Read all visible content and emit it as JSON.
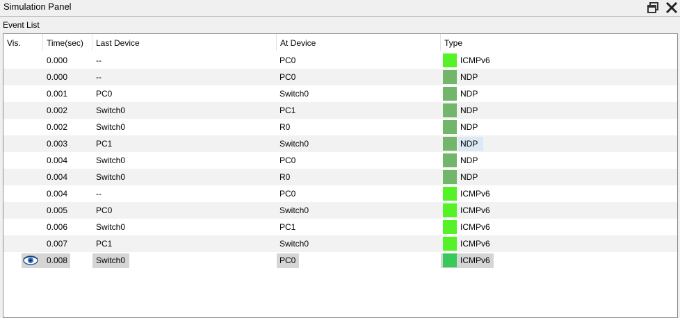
{
  "window": {
    "title": "Simulation Panel",
    "restore_icon": "restore-window-icon",
    "close_icon": "close-icon"
  },
  "event_list": {
    "label": "Event List",
    "columns": [
      "Vis.",
      "Time(sec)",
      "Last Device",
      "At Device",
      "Type"
    ],
    "colors": {
      "icmpv6": "#55f227",
      "ndp": "#72b66c",
      "icmpv6_selected": "#39c95a"
    },
    "rows": [
      {
        "time": "0.000",
        "last": "--",
        "at": "PC0",
        "type": "ICMPv6"
      },
      {
        "time": "0.000",
        "last": "--",
        "at": "PC0",
        "type": "NDP"
      },
      {
        "time": "0.001",
        "last": "PC0",
        "at": "Switch0",
        "type": "NDP"
      },
      {
        "time": "0.002",
        "last": "Switch0",
        "at": "PC1",
        "type": "NDP"
      },
      {
        "time": "0.002",
        "last": "Switch0",
        "at": "R0",
        "type": "NDP"
      },
      {
        "time": "0.003",
        "last": "PC1",
        "at": "Switch0",
        "type": "NDP",
        "highlight": true
      },
      {
        "time": "0.004",
        "last": "Switch0",
        "at": "PC0",
        "type": "NDP"
      },
      {
        "time": "0.004",
        "last": "Switch0",
        "at": "R0",
        "type": "NDP"
      },
      {
        "time": "0.004",
        "last": "--",
        "at": "PC0",
        "type": "ICMPv6"
      },
      {
        "time": "0.005",
        "last": "PC0",
        "at": "Switch0",
        "type": "ICMPv6"
      },
      {
        "time": "0.006",
        "last": "Switch0",
        "at": "PC1",
        "type": "ICMPv6"
      },
      {
        "time": "0.007",
        "last": "PC1",
        "at": "Switch0",
        "type": "ICMPv6"
      },
      {
        "time": "0.008",
        "last": "Switch0",
        "at": "PC0",
        "type": "ICMPv6",
        "current": true,
        "vis_icon": "eye-icon"
      }
    ]
  }
}
